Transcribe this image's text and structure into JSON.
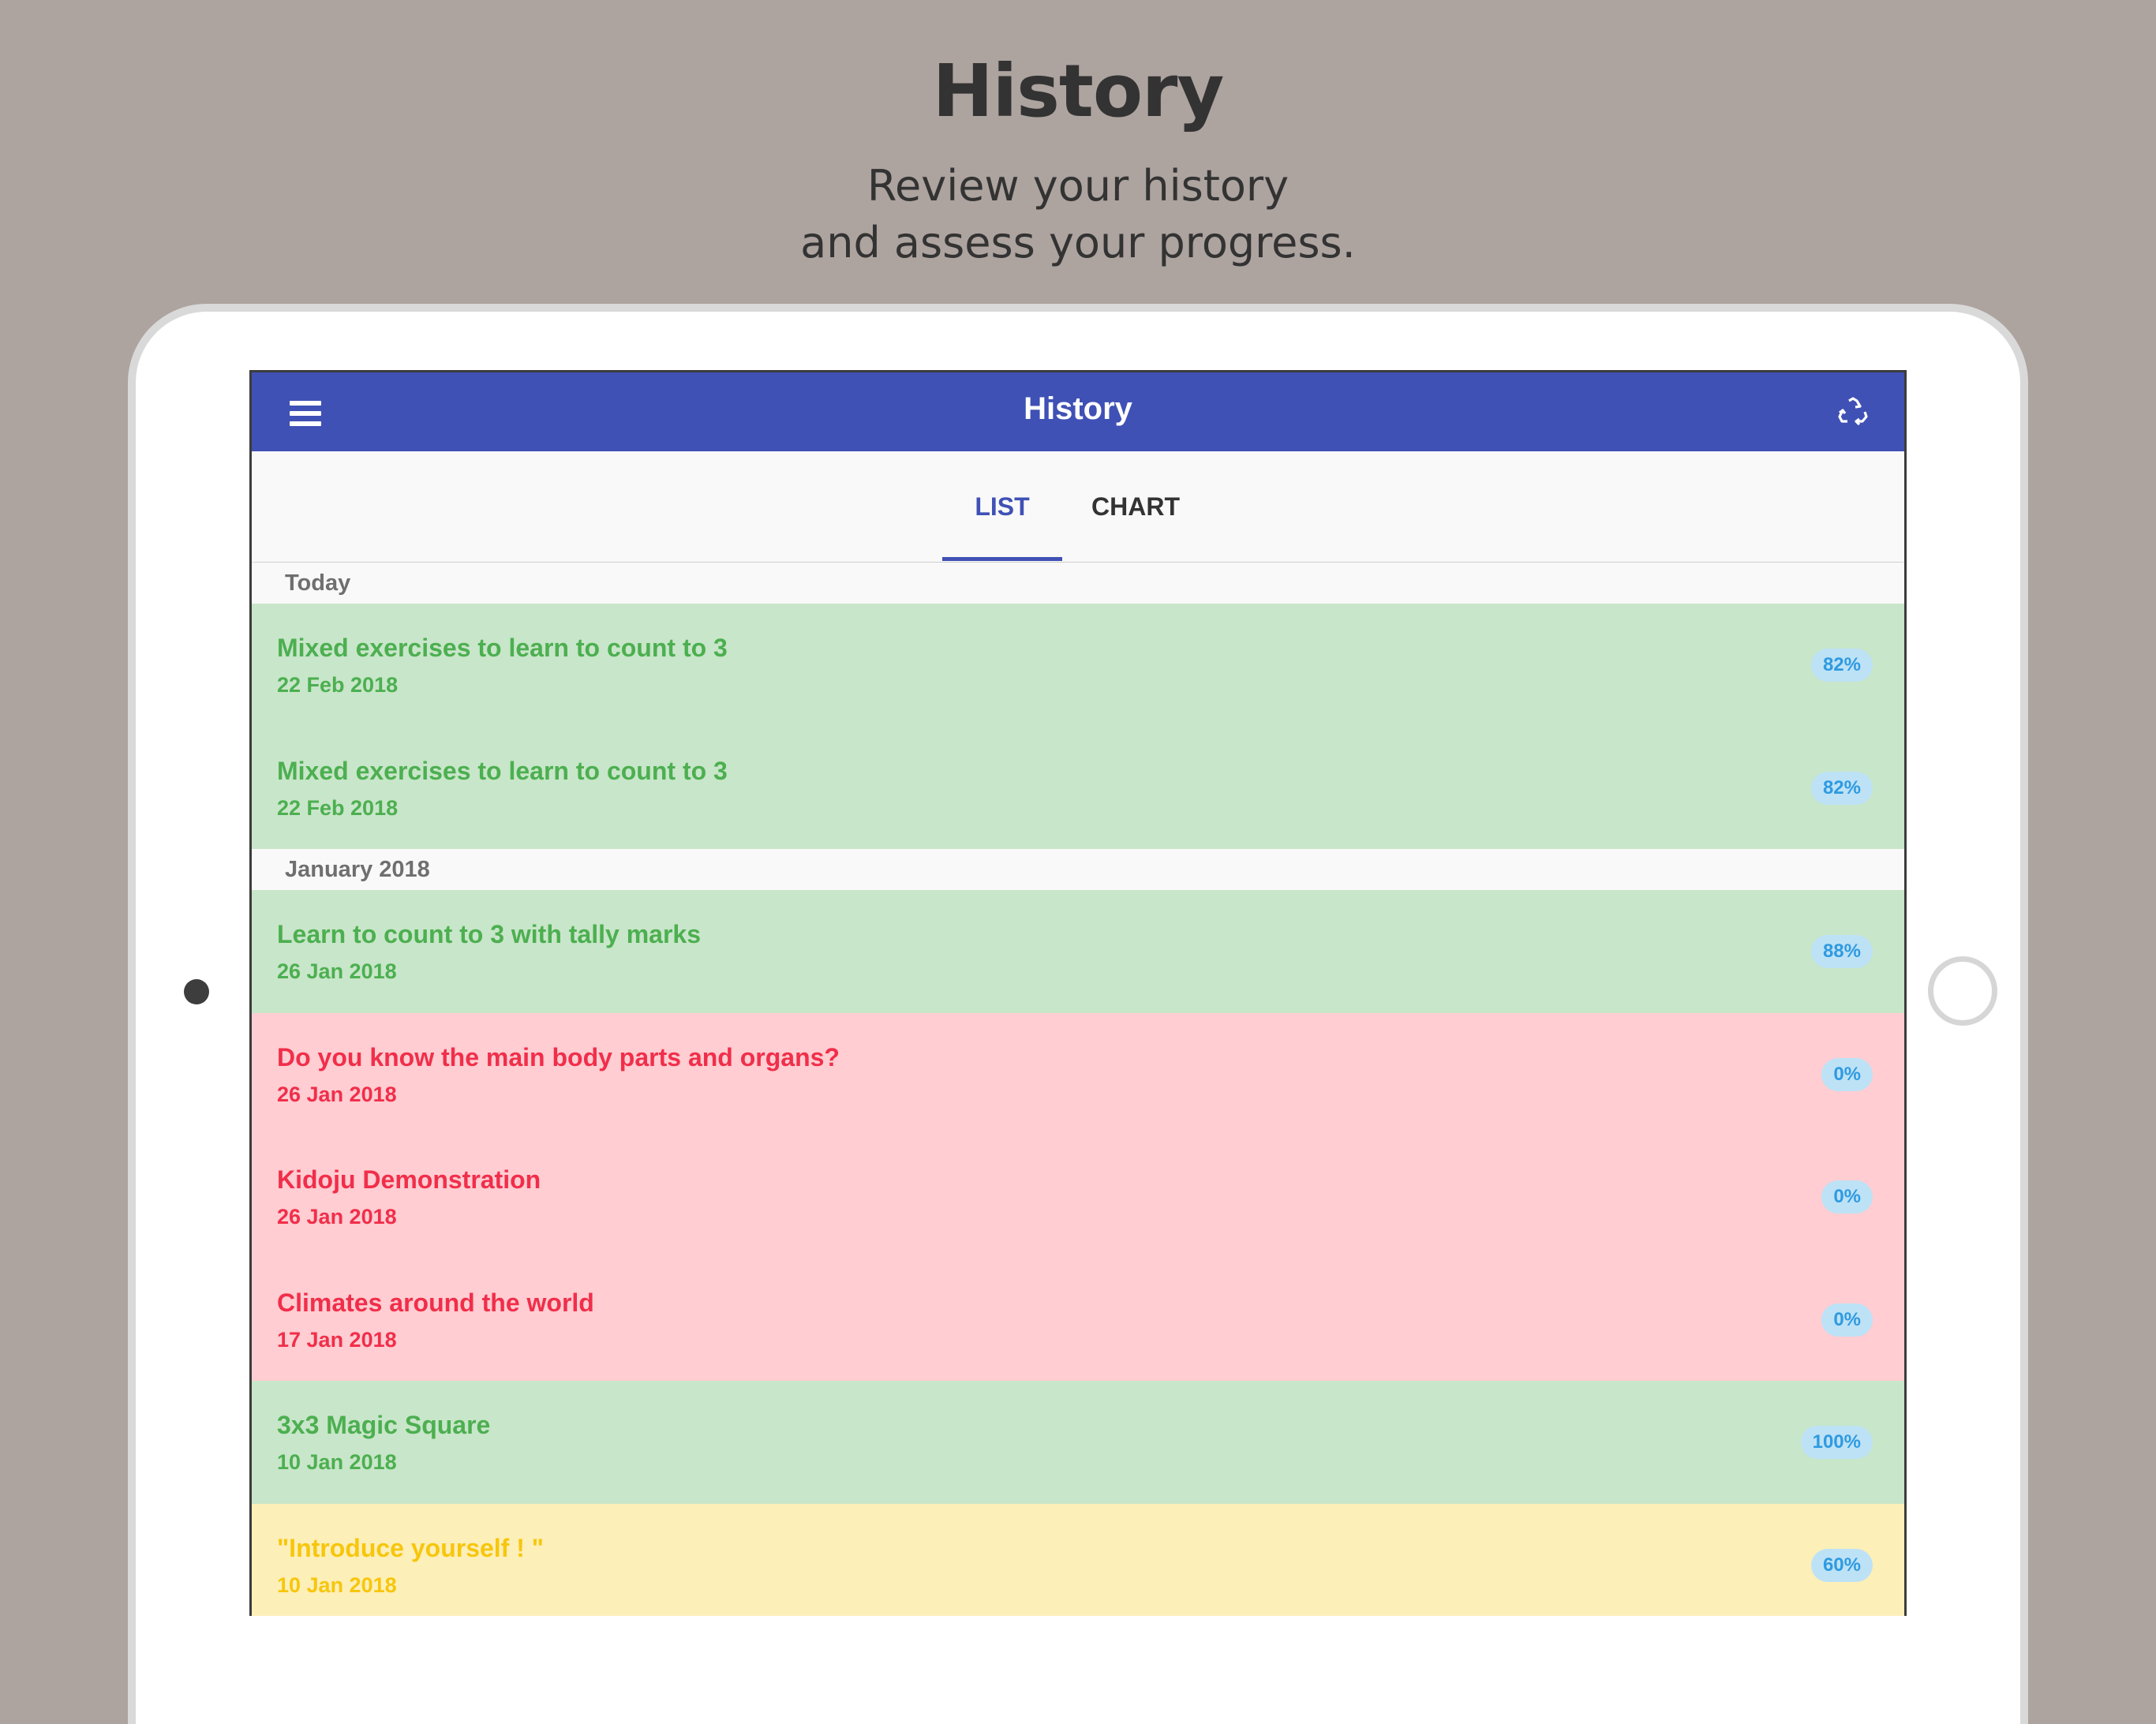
{
  "promo": {
    "title": "History",
    "subtitle_line1": "Review your history",
    "subtitle_line2": "and assess your progress."
  },
  "appbar": {
    "title": "History",
    "menu_icon": "hamburger-menu-icon",
    "action_icon": "recycle-icon",
    "color": "#3f51b5"
  },
  "tabs": [
    {
      "label": "LIST",
      "active": true
    },
    {
      "label": "CHART",
      "active": false
    }
  ],
  "sections": [
    {
      "header": "Today",
      "items": [
        {
          "title": "Mixed exercises to learn to count to 3",
          "date": "22 Feb 2018",
          "score": "82%",
          "status": "green"
        },
        {
          "title": "Mixed exercises to learn to count to 3",
          "date": "22 Feb 2018",
          "score": "82%",
          "status": "green"
        }
      ]
    },
    {
      "header": "January 2018",
      "items": [
        {
          "title": "Learn to count to 3 with tally marks",
          "date": "26 Jan 2018",
          "score": "88%",
          "status": "green"
        },
        {
          "title": "Do you know the main body parts and organs?",
          "date": "26 Jan 2018",
          "score": "0%",
          "status": "red"
        },
        {
          "title": "Kidoju Demonstration",
          "date": "26 Jan 2018",
          "score": "0%",
          "status": "red"
        },
        {
          "title": "Climates around the world",
          "date": "17 Jan 2018",
          "score": "0%",
          "status": "red"
        },
        {
          "title": "3x3 Magic Square",
          "date": "10 Jan 2018",
          "score": "100%",
          "status": "green"
        },
        {
          "title": "\"Introduce yourself ! \"",
          "date": "10 Jan 2018",
          "score": "60%",
          "status": "yellow"
        }
      ]
    }
  ],
  "colors": {
    "green_bg": "#c8e6c9",
    "green_text": "#4caf50",
    "red_bg": "#ffcdd2",
    "red_text": "#f12e4a",
    "yellow_bg": "#fdefb8",
    "yellow_text": "#f7c60c",
    "badge_bg": "#bde2f6",
    "badge_text": "#2f9ae0"
  }
}
